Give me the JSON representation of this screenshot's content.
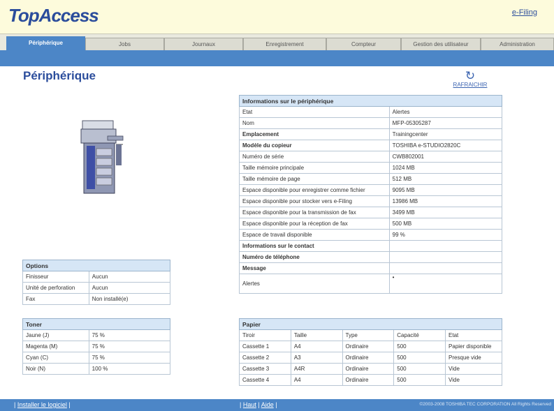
{
  "header": {
    "logo": "TopAccess",
    "efiling_link": "e-Filing"
  },
  "tabs": [
    {
      "label": "Périphérique",
      "active": true
    },
    {
      "label": "Jobs",
      "active": false
    },
    {
      "label": "Journaux",
      "active": false
    },
    {
      "label": "Enregistrement",
      "active": false
    },
    {
      "label": "Compteur",
      "active": false
    },
    {
      "label": "Gestion des utilisateur",
      "active": false
    },
    {
      "label": "Administration",
      "active": false
    }
  ],
  "page": {
    "title": "Périphérique",
    "refresh_label": "RAFRAICHIR",
    "refresh_icon": "refresh-icon"
  },
  "device_info": {
    "header": "Informations sur le périphérique",
    "rows": [
      [
        "Etat",
        "Alertes"
      ],
      [
        "Nom",
        "MFP-05305287"
      ],
      [
        "Emplacement",
        "Trainingcenter"
      ],
      [
        "Modèle du copieur",
        "TOSHIBA e-STUDIO2820C"
      ],
      [
        "Numéro de série",
        "CWB802001"
      ],
      [
        "Taille mémoire principale",
        "1024 MB"
      ],
      [
        "Taille mémoire de page",
        "512 MB"
      ],
      [
        "Espace disponible pour enregistrer comme fichier",
        "9095 MB"
      ],
      [
        "Espace disponible pour stocker vers e-Filing",
        "13986 MB"
      ],
      [
        "Espace disponible pour la transmission de fax",
        "3499 MB"
      ],
      [
        "Espace disponible pour la réception de fax",
        "500 MB"
      ],
      [
        "Espace de travail disponible",
        "99 %"
      ],
      [
        "Informations sur le contact",
        ""
      ],
      [
        "Numéro de téléphone",
        ""
      ],
      [
        "Message",
        ""
      ],
      [
        "Alertes",
        "•"
      ]
    ]
  },
  "options": {
    "header": "Options",
    "rows": [
      [
        "Finisseur",
        "Aucun"
      ],
      [
        "Unité de perforation",
        "Aucun"
      ],
      [
        "Fax",
        "Non installé(e)"
      ]
    ]
  },
  "toner": {
    "header": "Toner",
    "rows": [
      [
        "Jaune (J)",
        "75 %"
      ],
      [
        "Magenta (M)",
        "75 %"
      ],
      [
        "Cyan (C)",
        "75 %"
      ],
      [
        "Noir (N)",
        "100 %"
      ]
    ]
  },
  "paper": {
    "header": "Papier",
    "columns": [
      "Tiroir",
      "Taille",
      "Type",
      "Capacité",
      "Etat"
    ],
    "rows": [
      [
        "Cassette 1",
        "A4",
        "Ordinaire",
        "500",
        "Papier disponible"
      ],
      [
        "Cassette 2",
        "A3",
        "Ordinaire",
        "500",
        "Presque vide"
      ],
      [
        "Cassette 3",
        "A4R",
        "Ordinaire",
        "500",
        "Vide"
      ],
      [
        "Cassette 4",
        "A4",
        "Ordinaire",
        "500",
        "Vide"
      ]
    ]
  },
  "footer": {
    "install_link": "Installer le logiciel",
    "top_link": "Haut",
    "help_link": "Aide",
    "copyright": "©2003-2008 TOSHIBA TEC CORPORATION All Rights Reserved"
  }
}
